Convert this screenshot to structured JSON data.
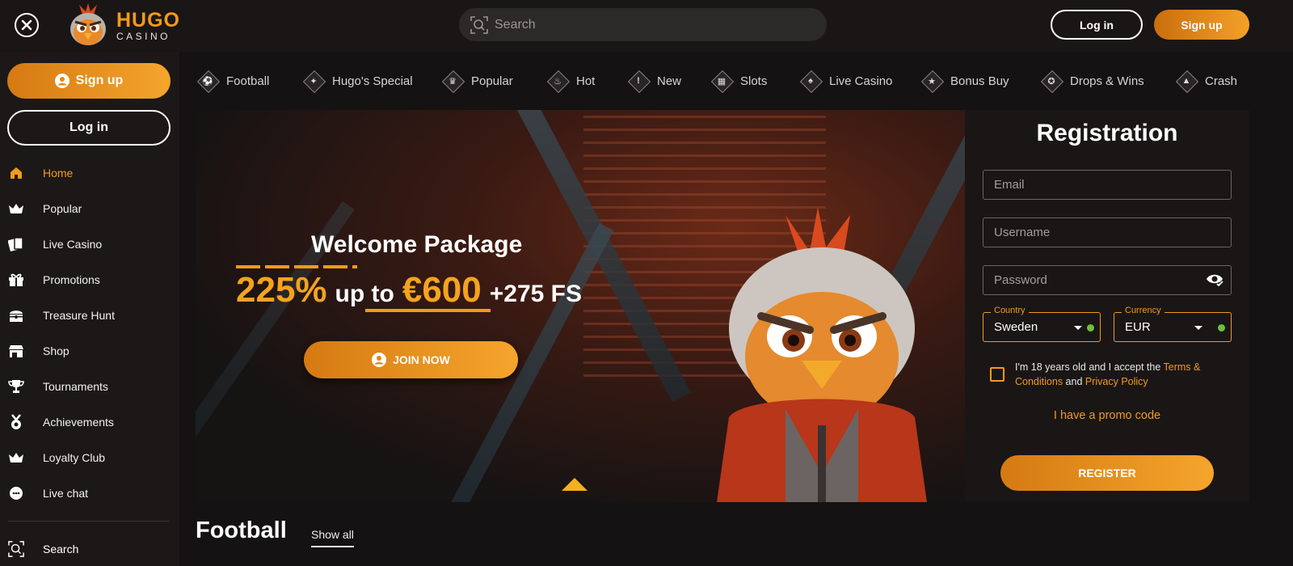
{
  "header": {
    "logo_name": "HUGO",
    "logo_sub": "CASINO",
    "search_placeholder": "Search",
    "login_label": "Log in",
    "signup_label": "Sign up"
  },
  "sidebar": {
    "signup_label": "Sign up",
    "login_label": "Log in",
    "items": [
      {
        "label": "Home",
        "icon": "home-icon",
        "active": true
      },
      {
        "label": "Popular",
        "icon": "crown-icon"
      },
      {
        "label": "Live Casino",
        "icon": "cards-icon"
      },
      {
        "label": "Promotions",
        "icon": "gift-icon"
      },
      {
        "label": "Treasure Hunt",
        "icon": "chest-icon"
      },
      {
        "label": "Shop",
        "icon": "shop-icon"
      },
      {
        "label": "Tournaments",
        "icon": "trophy-icon"
      },
      {
        "label": "Achievements",
        "icon": "medal-icon"
      },
      {
        "label": "Loyalty Club",
        "icon": "crown-icon"
      },
      {
        "label": "Live chat",
        "icon": "chat-icon"
      }
    ],
    "search_label": "Search"
  },
  "categories": [
    {
      "label": "Football",
      "icon": "football-icon"
    },
    {
      "label": "Hugo's Special",
      "icon": "diamond-icon"
    },
    {
      "label": "Popular",
      "icon": "crown-icon"
    },
    {
      "label": "Hot",
      "icon": "fire-icon"
    },
    {
      "label": "New",
      "icon": "exclamation-icon"
    },
    {
      "label": "Slots",
      "icon": "slot-machine-icon"
    },
    {
      "label": "Live Casino",
      "icon": "cards-icon"
    },
    {
      "label": "Bonus Buy",
      "icon": "bonus-icon"
    },
    {
      "label": "Drops & Wins",
      "icon": "drops-icon"
    },
    {
      "label": "Crash",
      "icon": "rocket-icon"
    }
  ],
  "banner": {
    "title": "Welcome Package",
    "percent": "225%",
    "up_to": "up to",
    "amount": "€600",
    "free_spins": "+275 FS",
    "join_label": "JOIN NOW"
  },
  "registration": {
    "title": "Registration",
    "email_placeholder": "Email",
    "username_placeholder": "Username",
    "password_placeholder": "Password",
    "country_label": "Country",
    "country_value": "Sweden",
    "currency_label": "Currency",
    "currency_value": "EUR",
    "terms_prefix": "I'm 18 years old and I accept the ",
    "terms_link": "Terms & Conditions",
    "terms_and": " and ",
    "privacy_link": "Privacy Policy",
    "promo_code": "I have a promo code",
    "register_label": "REGISTER"
  },
  "section": {
    "title": "Football",
    "show_all": "Show all"
  },
  "colors": {
    "accent": "#f39a1b",
    "background": "#141212",
    "sidebar": "#1c1818",
    "valid": "#6fbf3b"
  }
}
